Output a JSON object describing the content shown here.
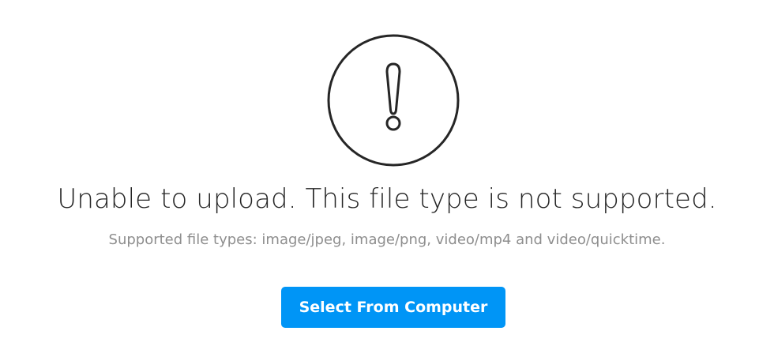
{
  "error": {
    "icon": "exclamation-circle-icon",
    "title": "Unable to upload. This file type is not supported.",
    "subtitle": "Supported file types: image/jpeg, image/png, video/mp4 and video/quicktime.",
    "button_label": "Select From Computer"
  },
  "colors": {
    "button_background": "#0095f6",
    "button_text": "#ffffff",
    "title_text": "#262626",
    "subtitle_text": "#8e8e8e",
    "icon_stroke": "#262626"
  }
}
